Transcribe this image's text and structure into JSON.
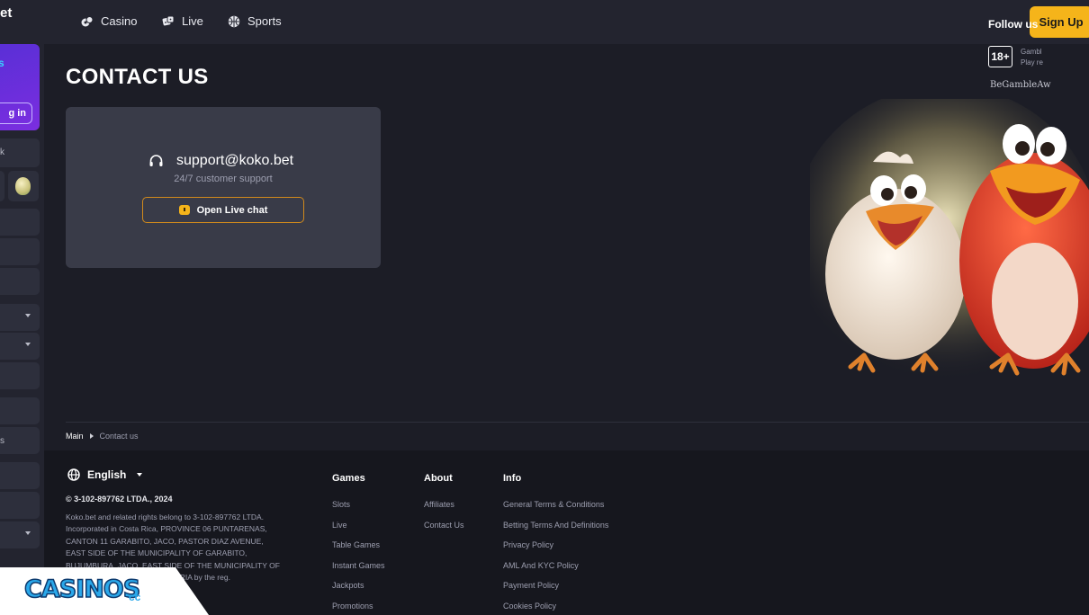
{
  "sidebar": {
    "logo_fragment": "et",
    "promo_mark": "s",
    "login_fragment": "g in",
    "item_fragments": [
      "k",
      "s"
    ]
  },
  "header": {
    "nav": [
      {
        "label": "Casino",
        "icon": "casino-chips-icon"
      },
      {
        "label": "Live",
        "icon": "dice-icon"
      },
      {
        "label": "Sports",
        "icon": "basketball-icon"
      }
    ],
    "signup_label": "Sign Up"
  },
  "main": {
    "title": "CONTACT US",
    "support_email": "support@koko.bet",
    "support_subtitle": "24/7 customer support",
    "chat_button_label": "Open Live chat"
  },
  "breadcrumb": {
    "main": "Main",
    "current": "Contact us"
  },
  "footer": {
    "language": "English",
    "copyright": "© 3-102-897762 LTDA., 2024",
    "legal_lines": [
      "Koko.bet and related rights belong to 3-102-897762 LTDA.",
      "Incorporated in Costa Rica, PROVINCE 06 PUNTARENAS,",
      "CANTON 11 GARABITO, JACO, PASTOR DIAZ AVENUE,",
      "EAST SIDE OF THE MUNICIPALITY OF GARABITO,",
      "BUJUMBURA, JACO, EAST SIDE OF THE MUNICIPALITY OF",
      "Z CHAVARRIA by the reg."
    ],
    "columns": [
      {
        "title": "Games",
        "links": [
          "Slots",
          "Live",
          "Table Games",
          "Instant Games",
          "Jackpots",
          "Promotions"
        ]
      },
      {
        "title": "About",
        "links": [
          "Affiliates",
          "Contact Us"
        ]
      },
      {
        "title": "Info",
        "links": [
          "General Terms & Conditions",
          "Betting Terms And Definitions",
          "Privacy Policy",
          "AML And KYC Policy",
          "Payment Policy",
          "Cookies Policy"
        ]
      }
    ],
    "follow_title": "Follow us",
    "age_badge": "18+",
    "gamble_fragment_1": "Gambl",
    "gamble_fragment_2": "Play re",
    "begamble": "BeGambleAw"
  },
  "watermark": {
    "text": "CASINOS",
    "suffix": "cc"
  },
  "colors": {
    "accent": "#f5b41a",
    "background": "#1c1d26",
    "card": "#393b48",
    "promo": "#6a2fe0"
  }
}
